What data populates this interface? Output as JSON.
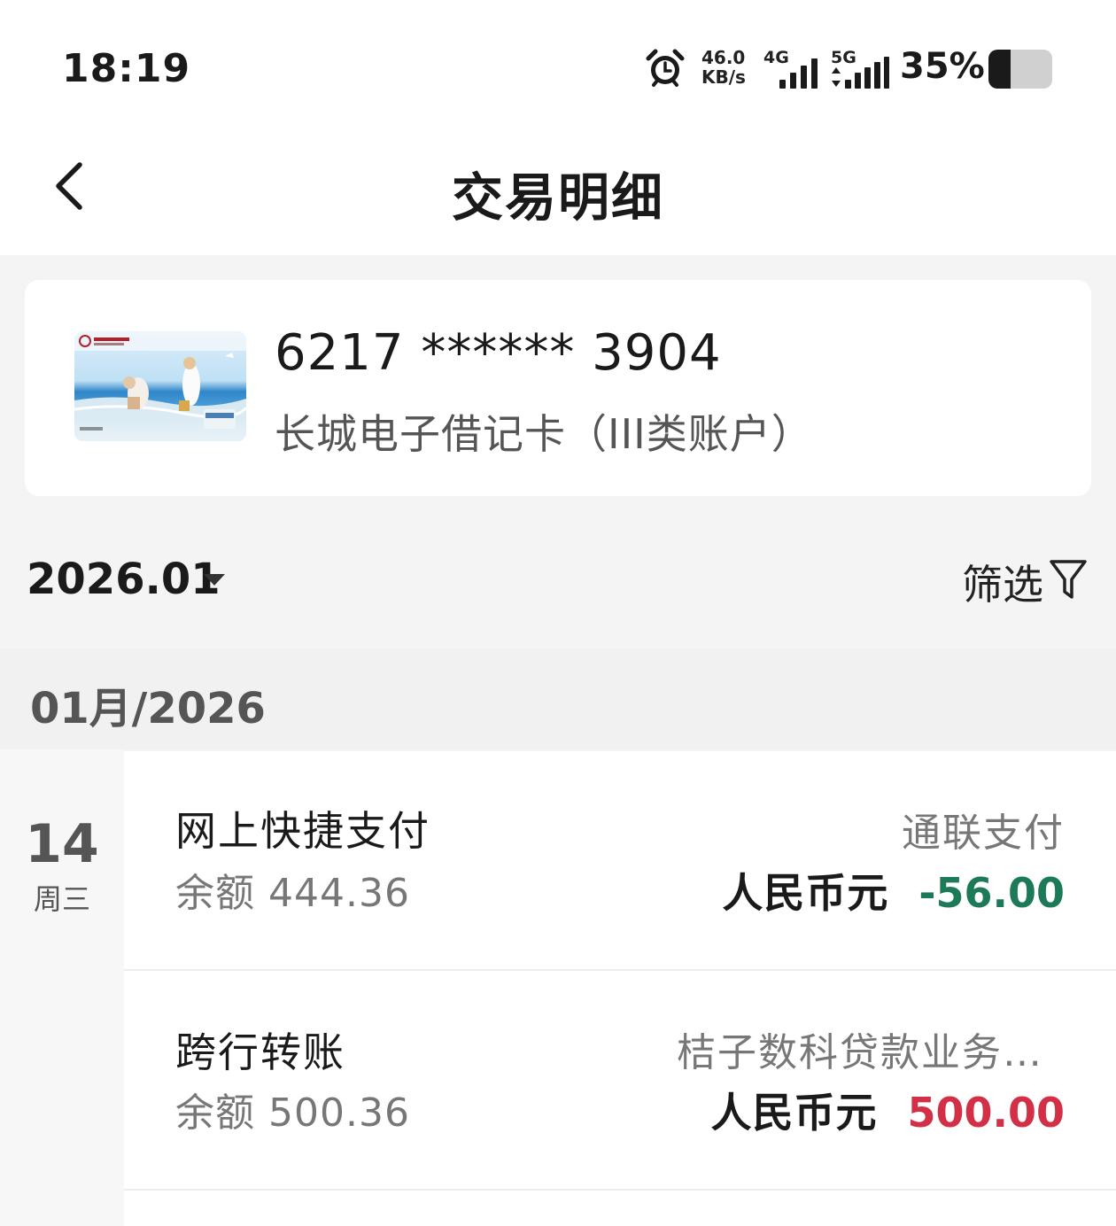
{
  "status_bar": {
    "time": "18:19",
    "net_speed_value": "46.0",
    "net_speed_unit": "KB/s",
    "net1": "4G",
    "net2": "5G",
    "battery_text": "35%",
    "battery_level": 0.35,
    "icons": [
      "alarm-icon",
      "signal-4g-icon",
      "signal-5g-icon",
      "battery-icon"
    ]
  },
  "header": {
    "title": "交易明细",
    "back_icon": "chevron-left-icon"
  },
  "card": {
    "number": "6217 ****** 3904",
    "type": "长城电子借记卡（III类账户）"
  },
  "filter_bar": {
    "month": "2026.01",
    "filter_label": "筛选",
    "filter_icon": "funnel-icon"
  },
  "section": {
    "label": "01月/2026"
  },
  "day_group": {
    "day": "14",
    "weekday": "周三"
  },
  "transactions": [
    {
      "name": "网上快捷支付",
      "balance": "余额 444.36",
      "party": "通联支付",
      "currency": "人民币元",
      "amount": "-56.00",
      "amount_color": "#1c7a58"
    },
    {
      "name": "跨行转账",
      "balance": "余额 500.36",
      "party": "桔子数科贷款业务…",
      "currency": "人民币元",
      "amount": "500.00",
      "amount_color": "#d32f47"
    }
  ]
}
